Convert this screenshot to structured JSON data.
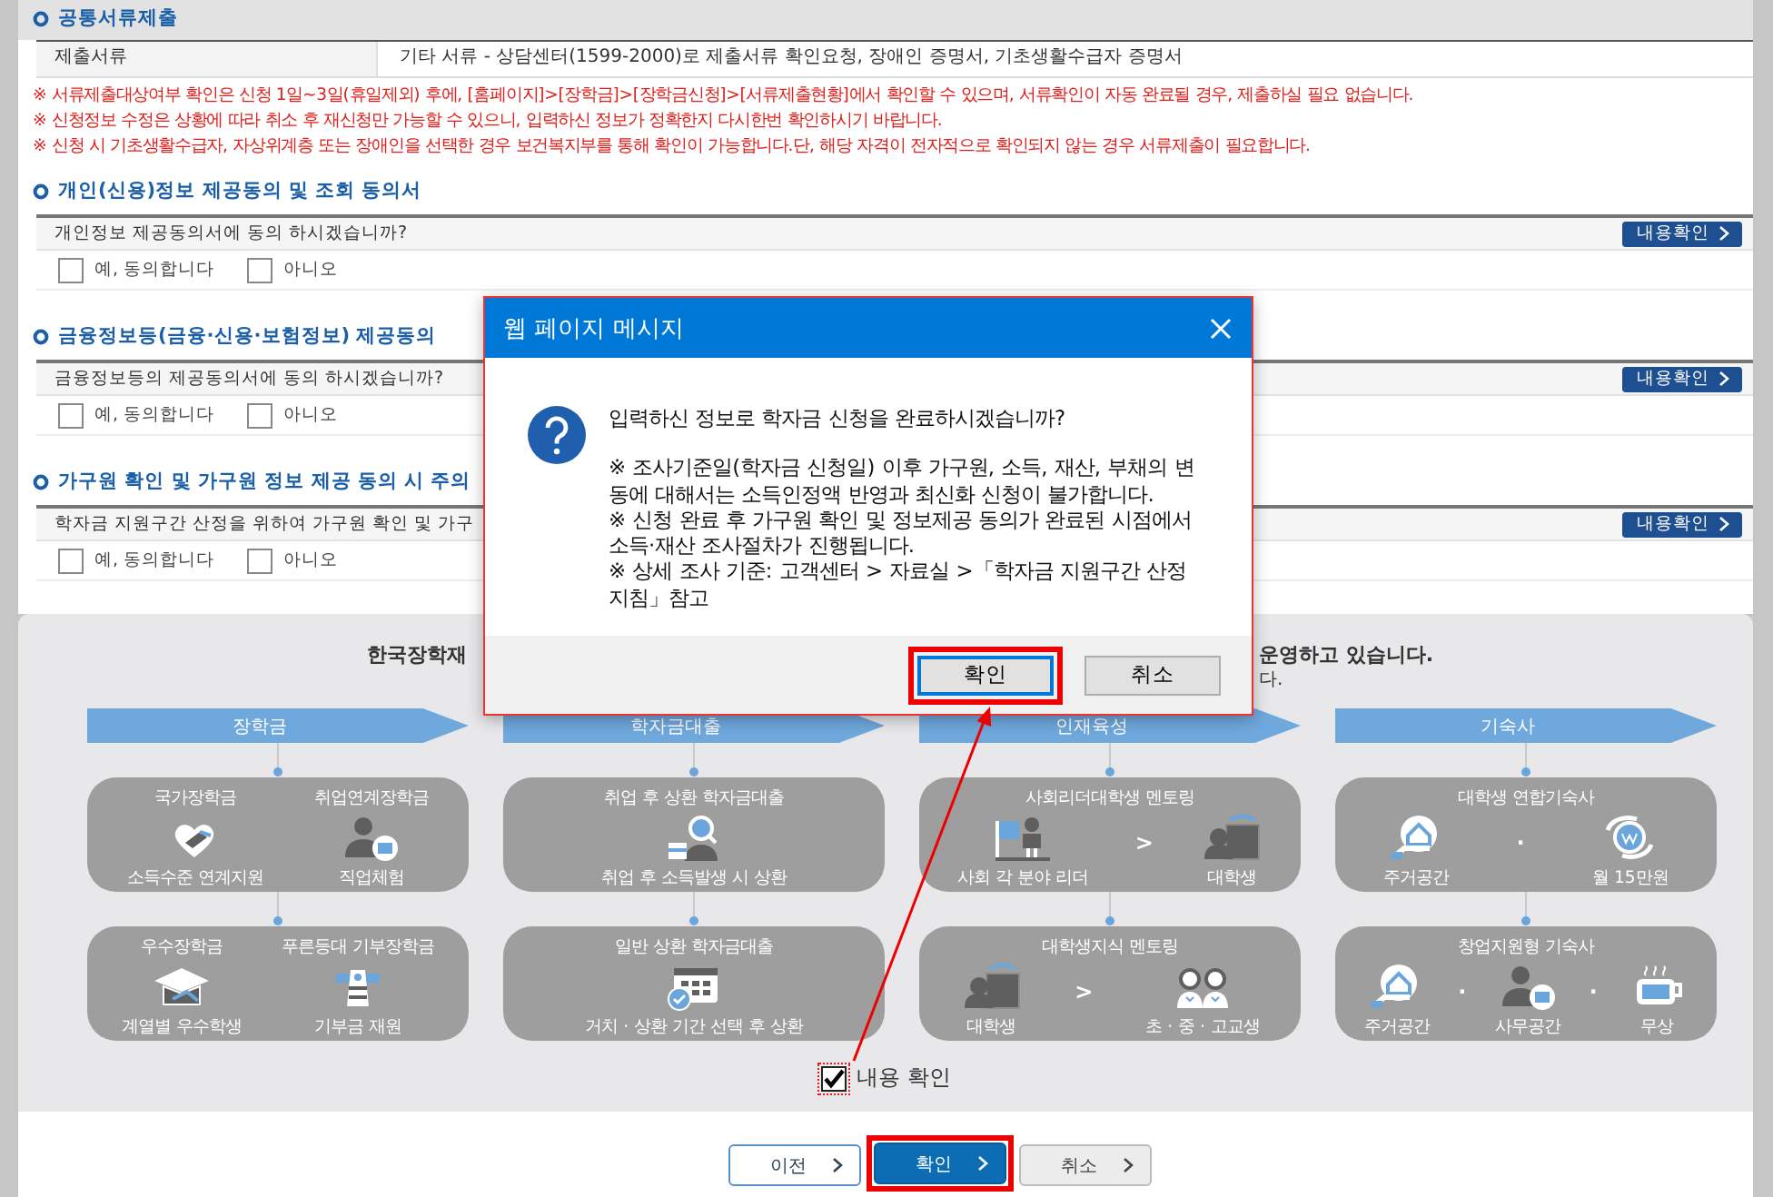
{
  "documents": {
    "heading": "공통서류제출",
    "label": "제출서류",
    "value": "기타 서류 - 상담센터(1599-2000)로 제출서류 확인요청, 장애인 증명서, 기초생활수급자 증명서",
    "notes": [
      "※ 서류제출대상여부 확인은 신청 1일~3일(휴일제외) 후에, [홈페이지]>[장학금]>[장학금신청]>[서류제출현황]에서 확인할 수 있으며, 서류확인이 자동 완료될 경우, 제출하실 필요 없습니다.",
      "※ 신청정보 수정은 상황에 따라 취소 후 재신청만 가능할 수 있으니, 입력하신 정보가 정확한지 다시한번 확인하시기 바랍니다.",
      "※ 신청 시 기초생활수급자, 자상위계층 또는 장애인을 선택한 경우 보건복지부를 통해 확인이 가능합니다.단, 해당 자격이 전자적으로 확인되지 않는 경우 서류제출이 필요합니다."
    ]
  },
  "consents": [
    {
      "heading": "개인(신용)정보 제공동의 및 조회 동의서",
      "question": "개인정보 제공동의서에 동의 하시겠습니까?",
      "button": "내용확인",
      "options": [
        {
          "label": "예, 동의합니다",
          "checked": false
        },
        {
          "label": "아니오",
          "checked": false
        }
      ]
    },
    {
      "heading": "금융정보등(금융·신용·보험정보) 제공동의",
      "question": "금융정보등의 제공동의서에 동의 하시겠습니까?",
      "button": "내용확인",
      "options": [
        {
          "label": "예, 동의합니다",
          "checked": false
        },
        {
          "label": "아니오",
          "checked": false
        }
      ]
    },
    {
      "heading": "가구원 확인 및 가구원 정보 제공 동의 시 주의",
      "question": "학자금 지원구간 산정을 위하여 가구원 확인 및 가구",
      "button": "내용확인",
      "options": [
        {
          "label": "예, 동의합니다",
          "checked": false
        },
        {
          "label": "아니오",
          "checked": false
        }
      ]
    }
  ],
  "programs": {
    "intro_left": "한국장학재",
    "intro_right": [
      "운영하고 있습니다.",
      "다."
    ],
    "columns": [
      {
        "title": "장학금",
        "cards": [
          {
            "items": [
              {
                "title": "국가장학금",
                "caption": "소득수준 연계지원"
              },
              {
                "title": "취업연계장학금",
                "caption": "직업체험"
              }
            ]
          },
          {
            "items": [
              {
                "title": "우수장학금",
                "caption": "계열별 우수학생"
              },
              {
                "title": "푸른등대 기부장학금",
                "caption": "기부금 재원"
              }
            ]
          }
        ]
      },
      {
        "title": "학자금대출",
        "cards": [
          {
            "title": "취업 후 상환 학자금대출",
            "items": [
              {
                "caption": "취업 후 소득발생 시 상환"
              }
            ]
          },
          {
            "title": "일반 상환 학자금대출",
            "items": [
              {
                "caption": "거치 · 상환 기간 선택 후 상환"
              }
            ]
          }
        ]
      },
      {
        "title": "인재육성",
        "cards": [
          {
            "title": "사회리더대학생 멘토링",
            "separator": ">",
            "items": [
              {
                "caption": "사회 각 분야 리더"
              },
              {
                "caption": "대학생"
              }
            ]
          },
          {
            "title": "대학생지식 멘토링",
            "separator": ">",
            "items": [
              {
                "caption": "대학생"
              },
              {
                "caption": "초 · 중 · 고교생"
              }
            ]
          }
        ]
      },
      {
        "title": "기숙사",
        "cards": [
          {
            "title": "대학생 연합기숙사",
            "separator": "·",
            "items": [
              {
                "caption": "주거공간"
              },
              {
                "caption": "월 15만원"
              }
            ]
          },
          {
            "title": "창업지원형 기숙사",
            "separator": "·",
            "items": [
              {
                "caption": "주거공간"
              },
              {
                "caption": "사무공간"
              },
              {
                "caption": "무상"
              }
            ]
          }
        ]
      }
    ],
    "confirm": {
      "label": "내용 확인",
      "checked": true
    }
  },
  "buttons": [
    {
      "label": "이전",
      "kind": "outline",
      "highlighted": false
    },
    {
      "label": "확인",
      "kind": "primary",
      "highlighted": true
    },
    {
      "label": "취소",
      "kind": "gray",
      "highlighted": false
    }
  ],
  "dialog": {
    "title": "웹 페이지 메시지",
    "message": "입력하신 정보로 학자금 신청을 완료하시겠습니까?",
    "notes": [
      " ※ 조사기준일(학자금 신청일) 이후 가구원, 소득, 재산, 부채의 변동에 대해서는 소득인정액 반영과 최신화 신청이 불가합니다.",
      "※ 신청 완료 후 가구원 확인 및 정보제공 동의가 완료된 시점에서 소득·재산 조사절차가 진행됩니다.",
      "※ 상세 조사 기준: 고객센터 > 자료실 >「학자금 지원구간 산정지침」참고"
    ],
    "buttons": [
      {
        "label": "확인",
        "highlighted": true
      },
      {
        "label": "취소",
        "highlighted": false
      }
    ]
  }
}
